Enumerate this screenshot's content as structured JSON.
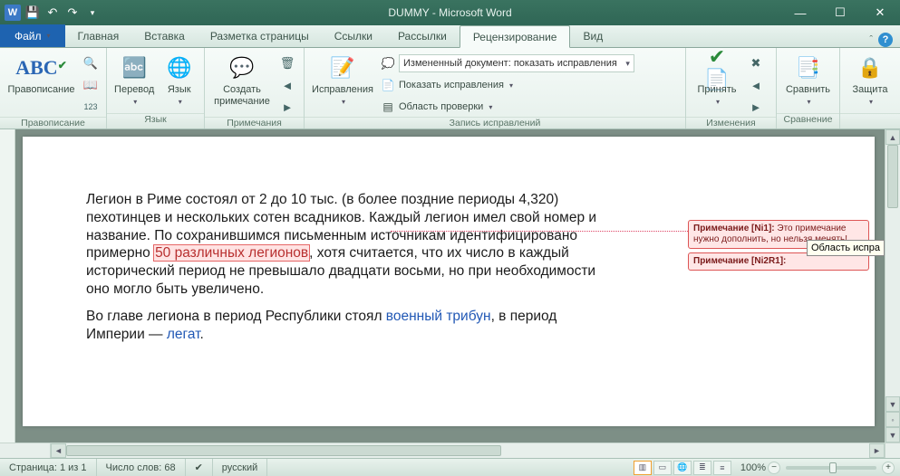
{
  "title": "DUMMY - Microsoft Word",
  "tabs": {
    "file": "Файл",
    "home": "Главная",
    "insert": "Вставка",
    "layout": "Разметка страницы",
    "references": "Ссылки",
    "mailings": "Рассылки",
    "review": "Рецензирование",
    "view": "Вид"
  },
  "ribbon": {
    "proofing": {
      "group": "Правописание",
      "spelling": "Правописание"
    },
    "language": {
      "group": "Язык",
      "translate": "Перевод",
      "lang": "Язык"
    },
    "notes": {
      "group": "Примечания",
      "new": "Создать примечание"
    },
    "tracking": {
      "group": "Запись исправлений",
      "track": "Исправления",
      "display": "Измененный документ: показать исправления",
      "showmarkup": "Показать исправления",
      "reviewpane": "Область проверки"
    },
    "changes": {
      "group": "Изменения",
      "accept": "Принять"
    },
    "compare": {
      "group": "Сравнение",
      "compare": "Сравнить"
    },
    "protect": {
      "group": "",
      "protect": "Защита"
    }
  },
  "document": {
    "p1a": "Легион в Риме состоял от 2 до 10 тыс. (в более поздние периоды 4,320) пехотинцев и нескольких сотен всадников. Каждый легион имел свой номер и название. По сохранившимся письменным источникам идентифицировано примерно ",
    "p1_hl": "50 различных легионов",
    "p1b": ", хотя считается, что их число в каждый исторический период не превышало двадцати восьми, но при необходимости оно могло быть увеличено.",
    "p2a": "Во главе легиона в период Республики стоял ",
    "p2_link1": "военный трибун",
    "p2b": ", в период Империи — ",
    "p2_link2": "легат",
    "p2c": "."
  },
  "comments": {
    "c1_label": "Примечание [Ni1]: ",
    "c1_text": "Это примечание нужно дополнить, но нельзя менять!",
    "c2_label": "Примечание [Ni2R1]:",
    "c2_text": ""
  },
  "tooltip": "Область испра",
  "status": {
    "page": "Страница: 1 из 1",
    "words": "Число слов: 68",
    "lang": "русский",
    "zoom": "100%"
  }
}
